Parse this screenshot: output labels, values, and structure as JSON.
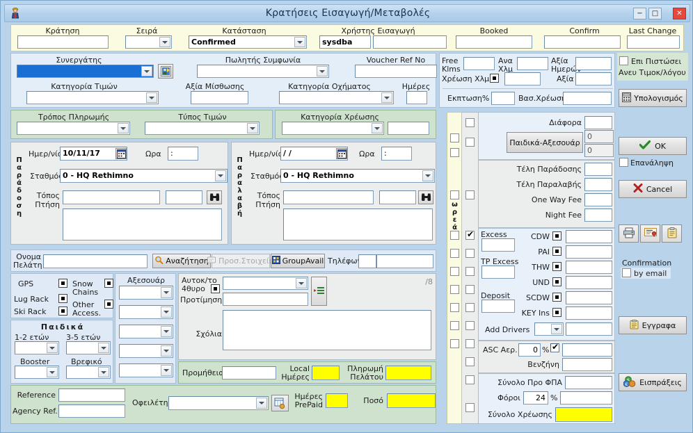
{
  "window": {
    "title": "Κρατήσεις Εισαγωγή/Μεταβολές",
    "app_icon": "person-icon",
    "minimize": "−",
    "maximize": "□",
    "close": "✕"
  },
  "header_row": {
    "fields": [
      {
        "label": "Κράτηση",
        "value": "",
        "type": "text"
      },
      {
        "label": "Σειρά",
        "value": "",
        "type": "select"
      },
      {
        "label": "Κατάσταση",
        "value": "Confirmed",
        "type": "select"
      },
      {
        "label": "Χρήστης Εισαγωγή",
        "value": "sysdba",
        "type": "text"
      },
      {
        "label": "Booked",
        "value": "",
        "type": "text"
      },
      {
        "label": "Confirm",
        "value": "",
        "type": "text"
      },
      {
        "label": "Last Change",
        "value": "",
        "type": "text"
      }
    ]
  },
  "agreement": {
    "partner_label": "Συνεργάτης",
    "partner_value": "",
    "partner_icon": "person-lookup-icon",
    "seller_label": "Πωλητής Συμφωνία",
    "seller_value": "",
    "voucher_label": "Voucher Ref No",
    "voucher_value": "",
    "price_category_label": "Κατηγορία Τιμών",
    "price_category_value": "",
    "rental_value_label": "Αξία Μίσθωσης",
    "rental_value": "",
    "vehicle_category_label": "Κατηγορία Οχήματος",
    "vehicle_category_value": "",
    "days_label": "Ημέρες",
    "days_value": ""
  },
  "payment": {
    "method_label": "Τρόπος Πληρωμής",
    "method_value": "",
    "price_type_label": "Τύπος Τιμών",
    "price_type_value": "",
    "charge_category_label": "Κατηγορία Χρέωσης",
    "charge_category_value": "",
    "charge_category_extra": ""
  },
  "delivery": {
    "side_label": "Παράδοση",
    "date_label": "Ημερ/νία",
    "date_value": "10/11/17",
    "calendar_icon": "calendar-icon",
    "time_label": "Ωρα",
    "time_value": ":",
    "station_label": "Σταθμός",
    "station_value": "0 - HQ Rethimno",
    "place_label": "Τόπος",
    "flight_label": "Πτήση",
    "place_value": "",
    "flight_value": "",
    "search_icon": "binoculars-icon",
    "notes_value": ""
  },
  "pickup": {
    "side_label": "Παραλαβή",
    "date_label": "Ημερ/νία",
    "date_value": "/  /",
    "calendar_icon": "calendar-icon",
    "time_label": "Ωρα",
    "time_value": ":",
    "station_label": "Σταθμός",
    "station_value": "0 - HQ Rethimno",
    "place_label": "Τόπος",
    "flight_label": "Πτήση",
    "place_value": "",
    "flight_value": "",
    "search_icon": "binoculars-icon",
    "notes_value": ""
  },
  "customer": {
    "name_label_1": "Ονομα",
    "name_label_2": "Πελάτη",
    "name_value": "",
    "search_button": "Αναζήτηση",
    "search_icon": "magnifier-icon",
    "extra_button": "Προσ.Στοιχεία",
    "extra_icon": "card-icon",
    "groupavail_button": "GroupAvail",
    "groupavail_icon": "grid-icon",
    "phone_label": "Τηλέφωνο",
    "phone_prefix": "",
    "phone_value": ""
  },
  "extras": {
    "gps_label": "GPS",
    "snow_chains_label": "Snow Chains",
    "lug_rack_label": "Lug Rack",
    "other_access_label": "Other Access.",
    "ski_rack_label": "Ski Rack",
    "children_title": "Παιδικά",
    "age_1_2_label": "1-2 ετών",
    "age_1_2_value": "",
    "age_3_5_label": "3-5 ετών",
    "age_3_5_value": "",
    "booster_label": "Booster",
    "booster_value": "",
    "baby_label": "Βρεφικό",
    "baby_value": "",
    "accessories_label": "Αξεσουάρ",
    "accessory_values": [
      "",
      "",
      "",
      "",
      ""
    ]
  },
  "vehicle_pref": {
    "car_label_1": "Αυτοκ/το",
    "car_label_2": "4θυρο",
    "car_value": "",
    "list_icon": "list-edit-icon",
    "counter": "/8",
    "preference_label": "Προτίμηση",
    "preference_value": "",
    "comments_label": "Σχόλια",
    "comments_value": ""
  },
  "commission": {
    "label": "Προμήθεια",
    "value": "",
    "local_days_label_1": "Local",
    "local_days_label_2": "Ημέρες",
    "local_days_value": "",
    "customer_payment_label_1": "Πληρωμή",
    "customer_payment_label_2": "Πελάτου",
    "customer_payment_value": ""
  },
  "refs": {
    "reference_label": "Reference",
    "reference_value": "",
    "agency_ref_label": "Agency Ref.",
    "agency_ref_value": "",
    "debtor_label": "Οφειλέτης",
    "debtor_value": "",
    "debtor_icon": "ledger-icon",
    "prepaid_days_label_1": "Ημέρες",
    "prepaid_days_label_2": "PrePaid",
    "prepaid_days_value": "",
    "amount_label": "Ποσό",
    "amount_value": ""
  },
  "kms": {
    "free_klms_label_1": "Free",
    "free_klms_label_2": "Klms",
    "free_klms_value": "",
    "per_km_label_1": "Ανα",
    "per_km_label_2": "Χλμ",
    "per_km_value": "",
    "days_value_label_1": "Αξία",
    "days_value_label_2": "Ημερών",
    "days_value": "",
    "km_charge_label": "Χρέωση Χλμ",
    "km_charge_value": "",
    "value_label": "Αξία",
    "value_value": "",
    "discount_label": "Εκπτωση%",
    "discount_value": "",
    "base_charge_label": "Βασ.Χρέωση",
    "base_charge_value": ""
  },
  "fees": {
    "free_column_label": "Δωρεάν",
    "misc_label": "Διάφορα",
    "misc_value": "",
    "children_accessories_button": "Παιδικά-Αξεσουάρ",
    "children_accessories_value_1": "0",
    "children_accessories_value_2": "0",
    "delivery_fee_label": "Τέλη Παράδοσης",
    "delivery_fee_value": "",
    "pickup_fee_label": "Τέλη Παραλαβής",
    "pickup_fee_value": "",
    "one_way_fee_label": "One Way Fee",
    "one_way_fee_value": "",
    "night_fee_label": "Night Fee",
    "night_fee_value": "",
    "excess_label": "Excess",
    "excess_value": "",
    "tp_excess_label": "TP Excess",
    "tp_excess_value": "",
    "deposit_label": "Deposit",
    "deposit_value": "",
    "insurances": [
      {
        "name": "CDW",
        "checked": true,
        "value": ""
      },
      {
        "name": "PAI",
        "checked": false,
        "value": ""
      },
      {
        "name": "THW",
        "checked": false,
        "value": ""
      },
      {
        "name": "UND",
        "checked": false,
        "value": ""
      },
      {
        "name": "SCDW",
        "checked": false,
        "value": ""
      },
      {
        "name": "KEY Ins",
        "checked": false,
        "value": ""
      }
    ],
    "add_drivers_label": "Add Drivers",
    "add_drivers_select": "",
    "add_drivers_value": "",
    "asc_label": "ASC Αερ.",
    "asc_percent": "0",
    "asc_percent_sign": "%",
    "asc_value": "",
    "fuel_label": "Βενζήνη",
    "fuel_value": "",
    "subtotal_label": "Σύνολο Προ ΦΠΑ",
    "subtotal_value": "",
    "tax_label": "Φόροι",
    "tax_percent": "24",
    "tax_percent_sign": "%",
    "tax_value": "",
    "total_label": "Σύνολο Χρέωσης",
    "total_value": ""
  },
  "sidebar": {
    "credit_label_1": "Επι Πιστώσει",
    "credit_label_2": "Ανευ Τιμοκ/λόγου",
    "calculate_button": "Υπολογισμός",
    "calculate_icon": "calculator-icon",
    "ok_button": "OK",
    "ok_icon": "check-icon",
    "repeat_label": "Επανάληψη",
    "cancel_button": "Cancel",
    "cancel_icon": "cross-icon",
    "print_icon": "printer-icon",
    "voucher_icon": "certificate-icon",
    "clipboard_icon": "clipboard-icon",
    "confirmation_label": "Confirmation",
    "by_email_label": "by email",
    "documents_button": "Εγγραφα",
    "documents_icon": "document-icon",
    "receipts_button": "Εισπράξεις",
    "receipts_icon": "money-icon"
  }
}
